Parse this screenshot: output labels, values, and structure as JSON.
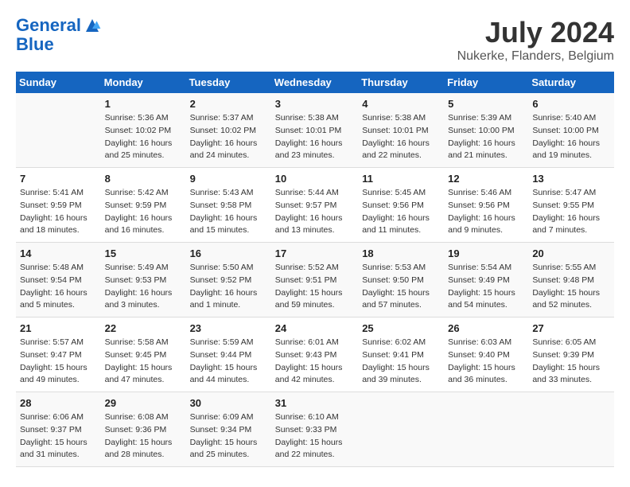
{
  "header": {
    "logo_line1": "General",
    "logo_line2": "Blue",
    "month_title": "July 2024",
    "location": "Nukerke, Flanders, Belgium"
  },
  "days_of_week": [
    "Sunday",
    "Monday",
    "Tuesday",
    "Wednesday",
    "Thursday",
    "Friday",
    "Saturday"
  ],
  "weeks": [
    [
      {
        "day": "",
        "sunrise": "",
        "sunset": "",
        "daylight": ""
      },
      {
        "day": "1",
        "sunrise": "Sunrise: 5:36 AM",
        "sunset": "Sunset: 10:02 PM",
        "daylight": "Daylight: 16 hours and 25 minutes."
      },
      {
        "day": "2",
        "sunrise": "Sunrise: 5:37 AM",
        "sunset": "Sunset: 10:02 PM",
        "daylight": "Daylight: 16 hours and 24 minutes."
      },
      {
        "day": "3",
        "sunrise": "Sunrise: 5:38 AM",
        "sunset": "Sunset: 10:01 PM",
        "daylight": "Daylight: 16 hours and 23 minutes."
      },
      {
        "day": "4",
        "sunrise": "Sunrise: 5:38 AM",
        "sunset": "Sunset: 10:01 PM",
        "daylight": "Daylight: 16 hours and 22 minutes."
      },
      {
        "day": "5",
        "sunrise": "Sunrise: 5:39 AM",
        "sunset": "Sunset: 10:00 PM",
        "daylight": "Daylight: 16 hours and 21 minutes."
      },
      {
        "day": "6",
        "sunrise": "Sunrise: 5:40 AM",
        "sunset": "Sunset: 10:00 PM",
        "daylight": "Daylight: 16 hours and 19 minutes."
      }
    ],
    [
      {
        "day": "7",
        "sunrise": "Sunrise: 5:41 AM",
        "sunset": "Sunset: 9:59 PM",
        "daylight": "Daylight: 16 hours and 18 minutes."
      },
      {
        "day": "8",
        "sunrise": "Sunrise: 5:42 AM",
        "sunset": "Sunset: 9:59 PM",
        "daylight": "Daylight: 16 hours and 16 minutes."
      },
      {
        "day": "9",
        "sunrise": "Sunrise: 5:43 AM",
        "sunset": "Sunset: 9:58 PM",
        "daylight": "Daylight: 16 hours and 15 minutes."
      },
      {
        "day": "10",
        "sunrise": "Sunrise: 5:44 AM",
        "sunset": "Sunset: 9:57 PM",
        "daylight": "Daylight: 16 hours and 13 minutes."
      },
      {
        "day": "11",
        "sunrise": "Sunrise: 5:45 AM",
        "sunset": "Sunset: 9:56 PM",
        "daylight": "Daylight: 16 hours and 11 minutes."
      },
      {
        "day": "12",
        "sunrise": "Sunrise: 5:46 AM",
        "sunset": "Sunset: 9:56 PM",
        "daylight": "Daylight: 16 hours and 9 minutes."
      },
      {
        "day": "13",
        "sunrise": "Sunrise: 5:47 AM",
        "sunset": "Sunset: 9:55 PM",
        "daylight": "Daylight: 16 hours and 7 minutes."
      }
    ],
    [
      {
        "day": "14",
        "sunrise": "Sunrise: 5:48 AM",
        "sunset": "Sunset: 9:54 PM",
        "daylight": "Daylight: 16 hours and 5 minutes."
      },
      {
        "day": "15",
        "sunrise": "Sunrise: 5:49 AM",
        "sunset": "Sunset: 9:53 PM",
        "daylight": "Daylight: 16 hours and 3 minutes."
      },
      {
        "day": "16",
        "sunrise": "Sunrise: 5:50 AM",
        "sunset": "Sunset: 9:52 PM",
        "daylight": "Daylight: 16 hours and 1 minute."
      },
      {
        "day": "17",
        "sunrise": "Sunrise: 5:52 AM",
        "sunset": "Sunset: 9:51 PM",
        "daylight": "Daylight: 15 hours and 59 minutes."
      },
      {
        "day": "18",
        "sunrise": "Sunrise: 5:53 AM",
        "sunset": "Sunset: 9:50 PM",
        "daylight": "Daylight: 15 hours and 57 minutes."
      },
      {
        "day": "19",
        "sunrise": "Sunrise: 5:54 AM",
        "sunset": "Sunset: 9:49 PM",
        "daylight": "Daylight: 15 hours and 54 minutes."
      },
      {
        "day": "20",
        "sunrise": "Sunrise: 5:55 AM",
        "sunset": "Sunset: 9:48 PM",
        "daylight": "Daylight: 15 hours and 52 minutes."
      }
    ],
    [
      {
        "day": "21",
        "sunrise": "Sunrise: 5:57 AM",
        "sunset": "Sunset: 9:47 PM",
        "daylight": "Daylight: 15 hours and 49 minutes."
      },
      {
        "day": "22",
        "sunrise": "Sunrise: 5:58 AM",
        "sunset": "Sunset: 9:45 PM",
        "daylight": "Daylight: 15 hours and 47 minutes."
      },
      {
        "day": "23",
        "sunrise": "Sunrise: 5:59 AM",
        "sunset": "Sunset: 9:44 PM",
        "daylight": "Daylight: 15 hours and 44 minutes."
      },
      {
        "day": "24",
        "sunrise": "Sunrise: 6:01 AM",
        "sunset": "Sunset: 9:43 PM",
        "daylight": "Daylight: 15 hours and 42 minutes."
      },
      {
        "day": "25",
        "sunrise": "Sunrise: 6:02 AM",
        "sunset": "Sunset: 9:41 PM",
        "daylight": "Daylight: 15 hours and 39 minutes."
      },
      {
        "day": "26",
        "sunrise": "Sunrise: 6:03 AM",
        "sunset": "Sunset: 9:40 PM",
        "daylight": "Daylight: 15 hours and 36 minutes."
      },
      {
        "day": "27",
        "sunrise": "Sunrise: 6:05 AM",
        "sunset": "Sunset: 9:39 PM",
        "daylight": "Daylight: 15 hours and 33 minutes."
      }
    ],
    [
      {
        "day": "28",
        "sunrise": "Sunrise: 6:06 AM",
        "sunset": "Sunset: 9:37 PM",
        "daylight": "Daylight: 15 hours and 31 minutes."
      },
      {
        "day": "29",
        "sunrise": "Sunrise: 6:08 AM",
        "sunset": "Sunset: 9:36 PM",
        "daylight": "Daylight: 15 hours and 28 minutes."
      },
      {
        "day": "30",
        "sunrise": "Sunrise: 6:09 AM",
        "sunset": "Sunset: 9:34 PM",
        "daylight": "Daylight: 15 hours and 25 minutes."
      },
      {
        "day": "31",
        "sunrise": "Sunrise: 6:10 AM",
        "sunset": "Sunset: 9:33 PM",
        "daylight": "Daylight: 15 hours and 22 minutes."
      },
      {
        "day": "",
        "sunrise": "",
        "sunset": "",
        "daylight": ""
      },
      {
        "day": "",
        "sunrise": "",
        "sunset": "",
        "daylight": ""
      },
      {
        "day": "",
        "sunrise": "",
        "sunset": "",
        "daylight": ""
      }
    ]
  ]
}
